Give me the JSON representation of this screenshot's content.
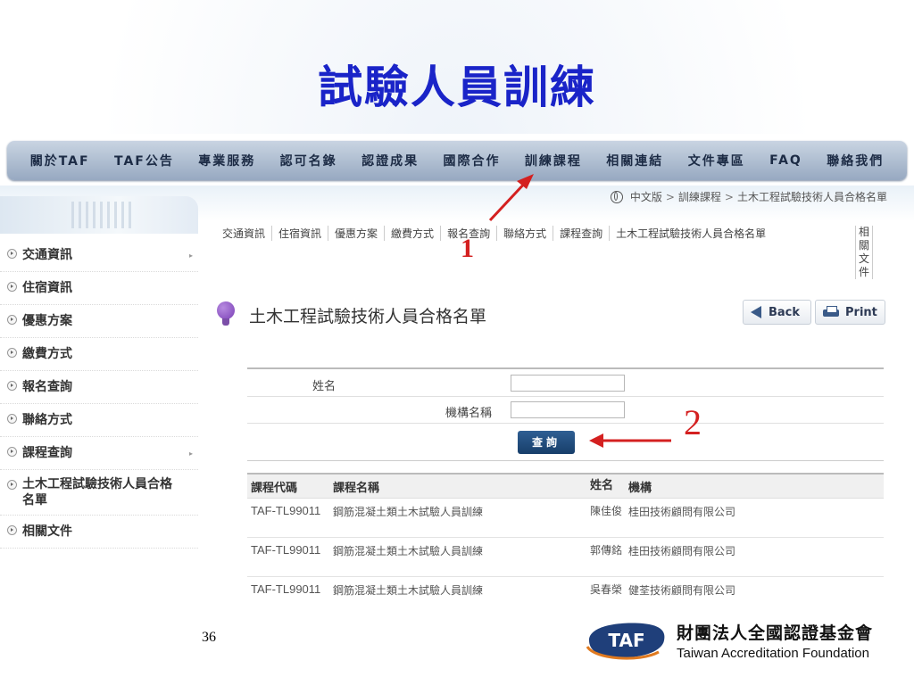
{
  "slide": {
    "title": "試驗人員訓練",
    "page_number": "36"
  },
  "navbar": {
    "items": [
      "關於TAF",
      "TAF公告",
      "專業服務",
      "認可名錄",
      "認證成果",
      "國際合作",
      "訓練課程",
      "相關連結",
      "文件專區",
      "FAQ",
      "聯絡我們"
    ]
  },
  "breadcrumb": {
    "items": [
      "中文版",
      "訓練課程",
      "土木工程試驗技術人員合格名單"
    ],
    "separator": ">"
  },
  "sidebar": {
    "items": [
      {
        "label": "交通資訊",
        "has_arrow": true
      },
      {
        "label": "住宿資訊",
        "has_arrow": false
      },
      {
        "label": "優惠方案",
        "has_arrow": false
      },
      {
        "label": "繳費方式",
        "has_arrow": false
      },
      {
        "label": "報名查詢",
        "has_arrow": false
      },
      {
        "label": "聯絡方式",
        "has_arrow": false
      },
      {
        "label": "課程查詢",
        "has_arrow": true
      },
      {
        "label": "土木工程試驗技術人員合格名單",
        "has_arrow": false
      },
      {
        "label": "相關文件",
        "has_arrow": false
      }
    ]
  },
  "subnav": {
    "items": [
      "交通資訊",
      "住宿資訊",
      "優惠方案",
      "繳費方式",
      "報名查詢",
      "聯絡方式",
      "課程查詢",
      "土木工程試驗技術人員合格名單"
    ],
    "last_vertical": "相關文件"
  },
  "content": {
    "page_title": "土木工程試驗技術人員合格名單",
    "back_label": "Back",
    "print_label": "Print"
  },
  "search_form": {
    "name_label": "姓名",
    "name_value": "",
    "org_label": "機構名稱",
    "org_value": "",
    "submit_label": "查詢"
  },
  "results_table": {
    "columns": [
      "課程代碼",
      "課程名稱",
      "姓名",
      "機構"
    ],
    "rows": [
      [
        "TAF-TL99011",
        "鋼筋混凝土類土木試驗人員訓練",
        "陳佳俊",
        "桂田技術顧問有限公司"
      ],
      [
        "TAF-TL99011",
        "鋼筋混凝土類土木試驗人員訓練",
        "郭傳銘",
        "桂田技術顧問有限公司"
      ],
      [
        "TAF-TL99011",
        "鋼筋混凝土類土木試驗人員訓練",
        "吳春榮",
        "健荃技術顧問有限公司"
      ]
    ]
  },
  "annotations": {
    "marker_1": "1",
    "marker_2": "2",
    "color": "#d42020"
  },
  "logo": {
    "badge_text": "TAF",
    "org_name_zh": "財團法人全國認證基金會",
    "org_name_en": "Taiwan Accreditation Foundation"
  },
  "colors": {
    "title": "#1a24c8",
    "navbar": "#97a9c1",
    "query_button": "#1f4a7a",
    "logo_blue": "#1f3f7a",
    "logo_orange": "#e07a20"
  }
}
